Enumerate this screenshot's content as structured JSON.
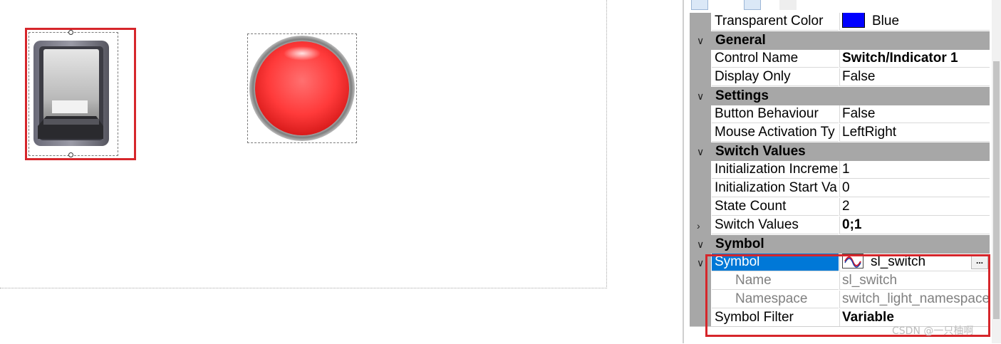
{
  "properties": {
    "top_row": {
      "name": "Transparent Color",
      "value": "Blue",
      "swatch_color": "#0000ff"
    },
    "categories": [
      {
        "label": "General",
        "rows": [
          {
            "name": "Control Name",
            "value": "Switch/Indicator 1",
            "bold": true
          },
          {
            "name": "Display Only",
            "value": "False"
          }
        ]
      },
      {
        "label": "Settings",
        "rows": [
          {
            "name": "Button Behaviour",
            "value": "False"
          },
          {
            "name": "Mouse Activation Ty",
            "value": "LeftRight"
          }
        ]
      },
      {
        "label": "Switch Values",
        "rows": [
          {
            "name": "Initialization Increme",
            "value": "1"
          },
          {
            "name": "Initialization Start Va",
            "value": "0"
          },
          {
            "name": "State Count",
            "value": "2"
          },
          {
            "name": "Switch Values",
            "value": "0;1",
            "bold": true
          }
        ]
      },
      {
        "label": "Symbol",
        "rows": [
          {
            "name": "Symbol",
            "value": "sl_switch",
            "selected": true,
            "icon": "sine-wave-icon"
          },
          {
            "name": "Name",
            "value": "sl_switch",
            "sub": true
          },
          {
            "name": "Namespace",
            "value": "switch_light_namespace",
            "sub": true
          },
          {
            "name": "Symbol Filter",
            "value": "Variable",
            "bold": true
          }
        ]
      }
    ],
    "ellipsis_label": "..."
  },
  "watermark": "CSDN @一只柚啊",
  "colors": {
    "highlight_outline": "#d6262b",
    "selection": "#0078d7",
    "category_bg": "#a7a7a7"
  }
}
